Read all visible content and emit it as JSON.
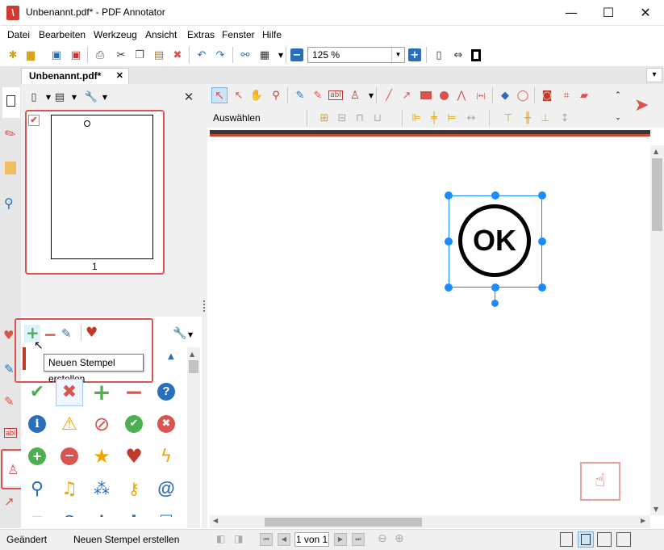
{
  "window": {
    "title": "Unbenannt.pdf* - PDF Annotator",
    "minimize": "—",
    "maximize": "☐",
    "close": "✕"
  },
  "menu": [
    "Datei",
    "Bearbeiten",
    "Werkzeug",
    "Ansicht",
    "Extras",
    "Fenster",
    "Hilfe"
  ],
  "toolbar": {
    "zoom_value": "125 %"
  },
  "tab": {
    "label": "Unbenannt.pdf*",
    "close": "✕",
    "dropdown": "▾"
  },
  "thumbnails": {
    "page_number": "1"
  },
  "annot_toolbar": {
    "mode_label": "Auswählen"
  },
  "stamp_panel": {
    "tooltip": "Neuen Stempel erstellen"
  },
  "canvas": {
    "stamp_text": "OK"
  },
  "statusbar": {
    "state": "Geändert",
    "hint": "Neuen Stempel erstellen",
    "page_display": "1 von 1"
  },
  "colors": {
    "accent_red": "#d9534f",
    "selection_blue": "#1a8cff",
    "green": "#4caf50",
    "blue": "#2a6ebb"
  }
}
